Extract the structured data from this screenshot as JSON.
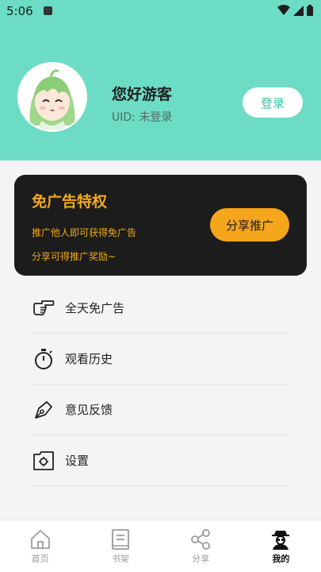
{
  "status_bar": {
    "time": "5:06"
  },
  "profile": {
    "greeting": "您好游客",
    "uid": "UID: 未登录",
    "login_label": "登录"
  },
  "promo": {
    "title": "免广告特权",
    "line1": "推广他人即可获得免广告",
    "line2": "分享可得推广奖励~",
    "share_label": "分享推广"
  },
  "menu": [
    {
      "label": "全天免广告",
      "icon": "pointing-hand-icon"
    },
    {
      "label": "观看历史",
      "icon": "stopwatch-icon"
    },
    {
      "label": "意见反馈",
      "icon": "pen-nib-icon"
    },
    {
      "label": "设置",
      "icon": "settings-icon"
    }
  ],
  "tabs": [
    {
      "label": "首页",
      "icon": "home-icon"
    },
    {
      "label": "书架",
      "icon": "book-icon"
    },
    {
      "label": "分享",
      "icon": "share-icon"
    },
    {
      "label": "我的",
      "icon": "profile-icon"
    }
  ],
  "colors": {
    "accent": "#6cdcc5",
    "promo_bg": "#1c1c1c",
    "promo_text": "#f2a81a",
    "share_button": "#f5a61a"
  }
}
